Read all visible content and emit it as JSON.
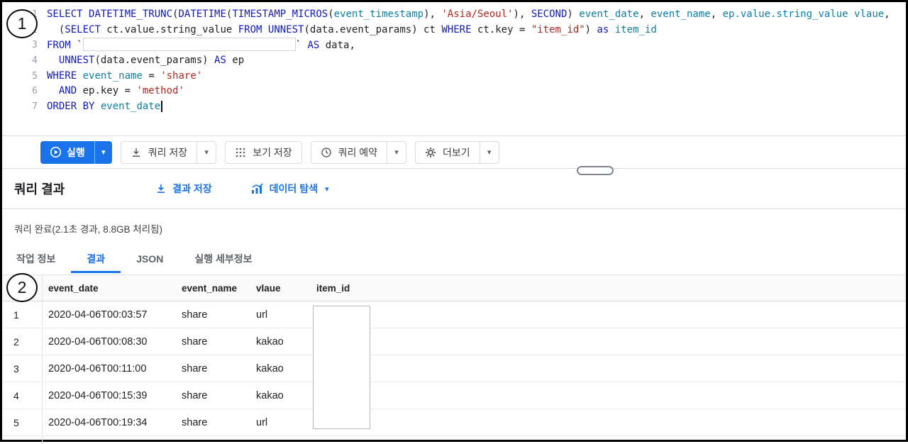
{
  "annotations": {
    "step1": "1",
    "step2": "2"
  },
  "editor": {
    "lines": [
      {
        "num": "1",
        "segments": [
          {
            "t": "k",
            "v": "SELECT "
          },
          {
            "t": "k",
            "v": "DATETIME_TRUNC"
          },
          {
            "t": "p",
            "v": "("
          },
          {
            "t": "k",
            "v": "DATETIME"
          },
          {
            "t": "p",
            "v": "("
          },
          {
            "t": "k",
            "v": "TIMESTAMP_MICROS"
          },
          {
            "t": "p",
            "v": "("
          },
          {
            "t": "i",
            "v": "event_timestamp"
          },
          {
            "t": "p",
            "v": "), "
          },
          {
            "t": "s",
            "v": "'Asia/Seoul'"
          },
          {
            "t": "p",
            "v": "), "
          },
          {
            "t": "k",
            "v": "SECOND"
          },
          {
            "t": "p",
            "v": ") "
          },
          {
            "t": "i",
            "v": "event_date"
          },
          {
            "t": "p",
            "v": ", "
          },
          {
            "t": "i",
            "v": "event_name"
          },
          {
            "t": "p",
            "v": ", "
          },
          {
            "t": "i",
            "v": "ep.value.string_value"
          },
          {
            "t": "p",
            "v": " "
          },
          {
            "t": "i",
            "v": "vlaue"
          },
          {
            "t": "p",
            "v": ","
          }
        ]
      },
      {
        "num": "2",
        "segments": [
          {
            "t": "p",
            "v": "  ("
          },
          {
            "t": "k",
            "v": "SELECT"
          },
          {
            "t": "p",
            "v": " ct.value.string_value "
          },
          {
            "t": "k",
            "v": "FROM"
          },
          {
            "t": "p",
            "v": " "
          },
          {
            "t": "k",
            "v": "UNNEST"
          },
          {
            "t": "p",
            "v": "(data.event_params) ct "
          },
          {
            "t": "k",
            "v": "WHERE"
          },
          {
            "t": "p",
            "v": " ct.key = "
          },
          {
            "t": "s",
            "v": "\"item_id\""
          },
          {
            "t": "p",
            "v": ") "
          },
          {
            "t": "k",
            "v": "as"
          },
          {
            "t": "p",
            "v": " "
          },
          {
            "t": "i",
            "v": "item_id"
          }
        ]
      },
      {
        "num": "3",
        "segments": [
          {
            "t": "k",
            "v": "FROM"
          },
          {
            "t": "p",
            "v": " `"
          },
          {
            "t": "redact",
            "v": ""
          },
          {
            "t": "p",
            "v": "` "
          },
          {
            "t": "k",
            "v": "AS"
          },
          {
            "t": "p",
            "v": " data,"
          }
        ]
      },
      {
        "num": "4",
        "segments": [
          {
            "t": "p",
            "v": "  "
          },
          {
            "t": "k",
            "v": "UNNEST"
          },
          {
            "t": "p",
            "v": "(data.event_params) "
          },
          {
            "t": "k",
            "v": "AS"
          },
          {
            "t": "p",
            "v": " ep"
          }
        ]
      },
      {
        "num": "5",
        "segments": [
          {
            "t": "k",
            "v": "WHERE"
          },
          {
            "t": "p",
            "v": " "
          },
          {
            "t": "i",
            "v": "event_name"
          },
          {
            "t": "p",
            "v": " = "
          },
          {
            "t": "s",
            "v": "'share'"
          }
        ]
      },
      {
        "num": "6",
        "segments": [
          {
            "t": "p",
            "v": "  "
          },
          {
            "t": "k",
            "v": "AND"
          },
          {
            "t": "p",
            "v": " ep.key = "
          },
          {
            "t": "s",
            "v": "'method'"
          }
        ]
      },
      {
        "num": "7",
        "segments": [
          {
            "t": "k",
            "v": "ORDER BY"
          },
          {
            "t": "p",
            "v": " "
          },
          {
            "t": "i",
            "v": "event_date"
          },
          {
            "t": "cursor",
            "v": ""
          }
        ]
      }
    ]
  },
  "toolbar": {
    "run_label": "실행",
    "save_query_label": "쿼리 저장",
    "save_view_label": "보기 저장",
    "schedule_label": "쿼리 예약",
    "more_label": "더보기"
  },
  "results": {
    "title": "쿼리 결과",
    "save_results_label": "결과 저장",
    "explore_data_label": "데이터 탐색",
    "status": "쿼리 완료(2.1초 경과, 8.8GB 처리됨)",
    "tabs": [
      {
        "label": "작업 정보",
        "name": "job-info",
        "active": false
      },
      {
        "label": "결과",
        "name": "results",
        "active": true
      },
      {
        "label": "JSON",
        "name": "json",
        "active": false
      },
      {
        "label": "실행 세부정보",
        "name": "execution-details",
        "active": false
      }
    ]
  },
  "table": {
    "columns": [
      "event_date",
      "event_name",
      "vlaue",
      "item_id"
    ],
    "rows": [
      {
        "n": "1",
        "cells": [
          "2020-04-06T00:03:57",
          "share",
          "url",
          ""
        ]
      },
      {
        "n": "2",
        "cells": [
          "2020-04-06T00:08:30",
          "share",
          "kakao",
          ""
        ]
      },
      {
        "n": "3",
        "cells": [
          "2020-04-06T00:11:00",
          "share",
          "kakao",
          ""
        ]
      },
      {
        "n": "4",
        "cells": [
          "2020-04-06T00:15:39",
          "share",
          "kakao",
          ""
        ]
      },
      {
        "n": "5",
        "cells": [
          "2020-04-06T00:19:34",
          "share",
          "url",
          ""
        ]
      }
    ]
  },
  "colors": {
    "accent_blue": "#1a73e8",
    "sql_keyword": "#1018bf",
    "sql_identifier": "#0b7fa6",
    "sql_string": "#b3261e",
    "sql_plain": "#202124"
  }
}
